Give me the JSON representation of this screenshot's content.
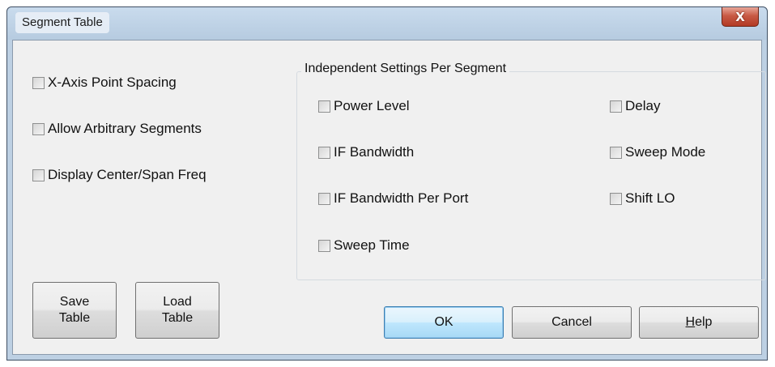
{
  "window": {
    "title": "Segment Table",
    "close_symbol": "X"
  },
  "left_options": [
    {
      "label": "X-Axis Point Spacing",
      "checked": false
    },
    {
      "label": "Allow Arbitrary Segments",
      "checked": false
    },
    {
      "label": "Display Center/Span Freq",
      "checked": false
    }
  ],
  "group": {
    "title": "Independent Settings Per Segment",
    "items": [
      {
        "label": "Power Level",
        "checked": false
      },
      {
        "label": "IF Bandwidth",
        "checked": false
      },
      {
        "label": "IF Bandwidth Per Port",
        "checked": false
      },
      {
        "label": "Sweep Time",
        "checked": false
      },
      {
        "label": "Delay",
        "checked": false
      },
      {
        "label": "Sweep Mode",
        "checked": false
      },
      {
        "label": "Shift LO",
        "checked": false
      }
    ]
  },
  "buttons": {
    "save_line1": "Save",
    "save_line2": "Table",
    "load_line1": "Load",
    "load_line2": "Table",
    "ok": "OK",
    "cancel": "Cancel",
    "help_mnemonic": "H",
    "help_rest": "elp"
  },
  "colors": {
    "titlebar": "#bdd0e3",
    "dialog_background": "#f0f0f0",
    "close_button": "#c85a45",
    "default_button_border": "#3c7fb1"
  }
}
